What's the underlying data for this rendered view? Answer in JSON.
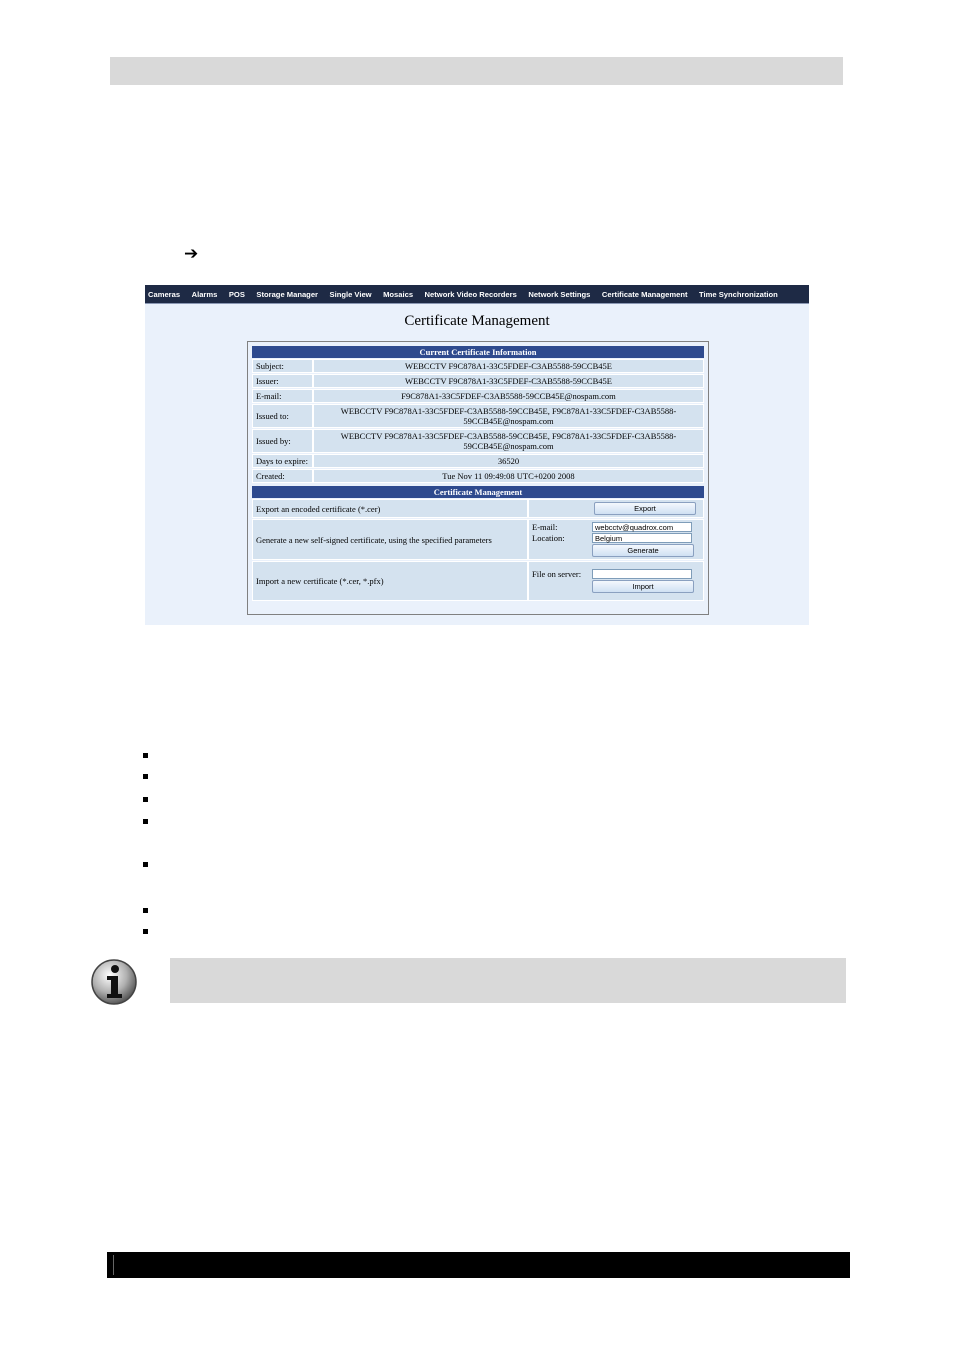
{
  "doc": {
    "arrow_glyph": "➔"
  },
  "app": {
    "nav_items": [
      "Cameras",
      "Alarms",
      "POS",
      "Storage Manager",
      "Single View",
      "Mosaics",
      "Network Video Recorders",
      "Network Settings",
      "Certificate Management",
      "Time Synchronization"
    ],
    "page_title": "Certificate Management"
  },
  "current": {
    "section_title": "Current Certificate Information",
    "subject_label": "Subject:",
    "subject_value": "WEBCCTV F9C878A1-33C5FDEF-C3AB5588-59CCB45E",
    "issuer_label": "Issuer:",
    "issuer_value": "WEBCCTV F9C878A1-33C5FDEF-C3AB5588-59CCB45E",
    "email_label": "E-mail:",
    "email_value": "F9C878A1-33C5FDEF-C3AB5588-59CCB45E@nospam.com",
    "issued_to_label": "Issued to:",
    "issued_to_value": "WEBCCTV F9C878A1-33C5FDEF-C3AB5588-59CCB45E, F9C878A1-33C5FDEF-C3AB5588-59CCB45E@nospam.com",
    "issued_by_label": "Issued by:",
    "issued_by_value": "WEBCCTV F9C878A1-33C5FDEF-C3AB5588-59CCB45E, F9C878A1-33C5FDEF-C3AB5588-59CCB45E@nospam.com",
    "days_label": "Days to expire:",
    "days_value": "36520",
    "created_label": "Created:",
    "created_value": "Tue Nov 11 09:49:08 UTC+0200 2008"
  },
  "management": {
    "section_title": "Certificate Management",
    "export_desc": "Export an encoded certificate (*.cer)",
    "export_button": "Export",
    "generate_desc": "Generate a new self-signed certificate, using the specified parameters",
    "email_label": "E-mail:",
    "email_value": "webcctv@quadrox.com",
    "location_label": "Location:",
    "location_value": "Belgium",
    "generate_button": "Generate",
    "import_desc": "Import a new certificate (*.cer, *.pfx)",
    "file_label": "File on server:",
    "file_value": "",
    "import_button": "Import"
  }
}
